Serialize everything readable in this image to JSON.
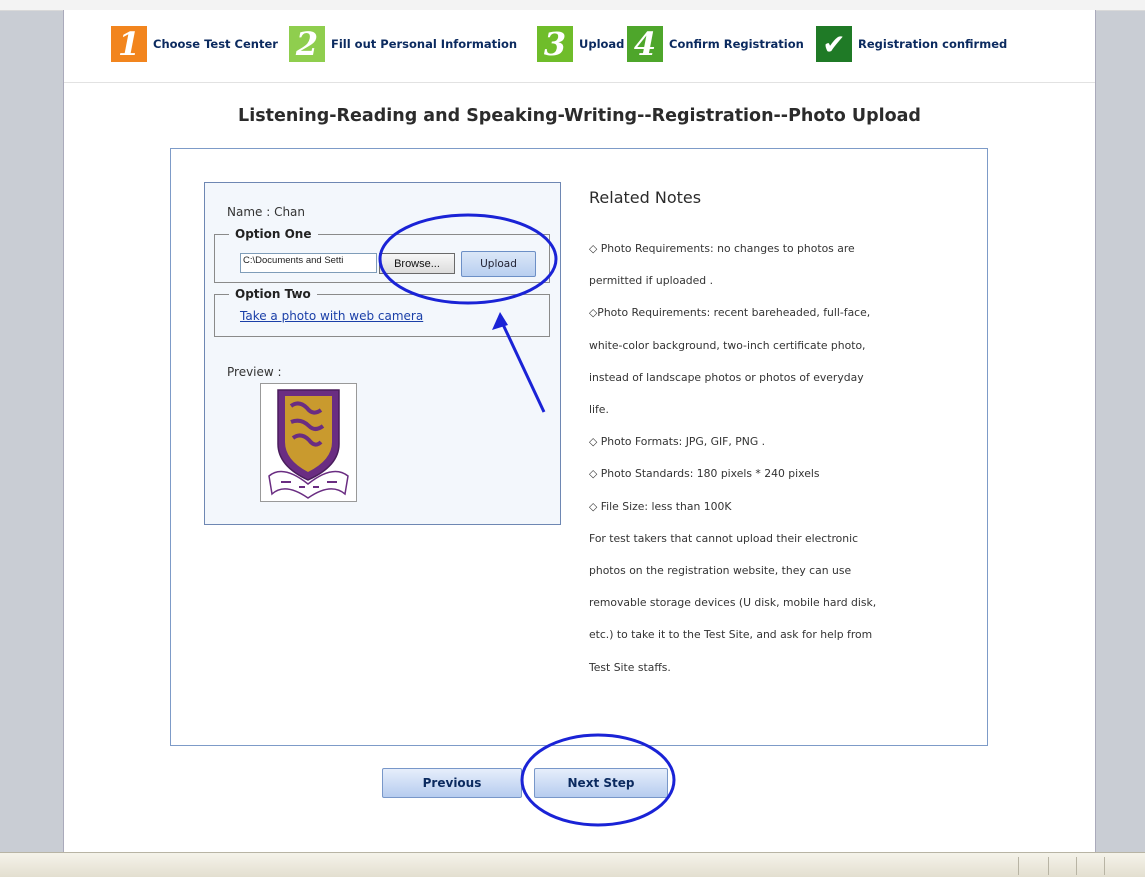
{
  "steps": [
    {
      "num": "1",
      "label": "Choose Test Center",
      "color": "#f2851e"
    },
    {
      "num": "2",
      "label": "Fill out Personal Information",
      "color": "#8fce4e"
    },
    {
      "num": "3",
      "label": "Upload",
      "color": "#6fbd2a"
    },
    {
      "num": "4",
      "label": "Confirm Registration",
      "color": "#4ea62b"
    },
    {
      "num": "✔",
      "label": "Registration confirmed",
      "color": "#1f7a26"
    }
  ],
  "page_title": "Listening-Reading and Speaking-Writing--Registration--Photo Upload",
  "form": {
    "name_line": "Name : Chan",
    "option_one_legend": "Option One",
    "file_path_value": "C:\\Documents and Setti",
    "browse_label": "Browse...",
    "upload_label": "Upload",
    "option_two_legend": "Option Two",
    "camera_link": "Take a photo with web camera",
    "preview_label": "Preview :"
  },
  "notes": {
    "title": "Related Notes",
    "items": [
      "◇ Photo Requirements: no changes to photos are",
      "permitted if uploaded .",
      "◇Photo Requirements: recent bareheaded, full-face,",
      "white-color background, two-inch certificate photo,",
      "instead of landscape photos or photos of everyday",
      "life.",
      "◇ Photo Formats: JPG, GIF, PNG .",
      "◇ Photo Standards: 180 pixels * 240 pixels",
      "◇ File Size: less than 100K",
      "For test takers that cannot upload their electronic",
      "photos on the registration website, they can use",
      "removable storage devices (U disk, mobile hard disk,",
      "etc.) to take it to the Test Site, and ask for help from",
      "Test Site staffs."
    ]
  },
  "nav": {
    "previous_label": "Previous",
    "next_label": "Next Step"
  },
  "colors": {
    "annotation": "#1a23d6",
    "link": "#1a3fa8",
    "crest_purple": "#6a2d82",
    "crest_gold": "#c99a2e"
  }
}
